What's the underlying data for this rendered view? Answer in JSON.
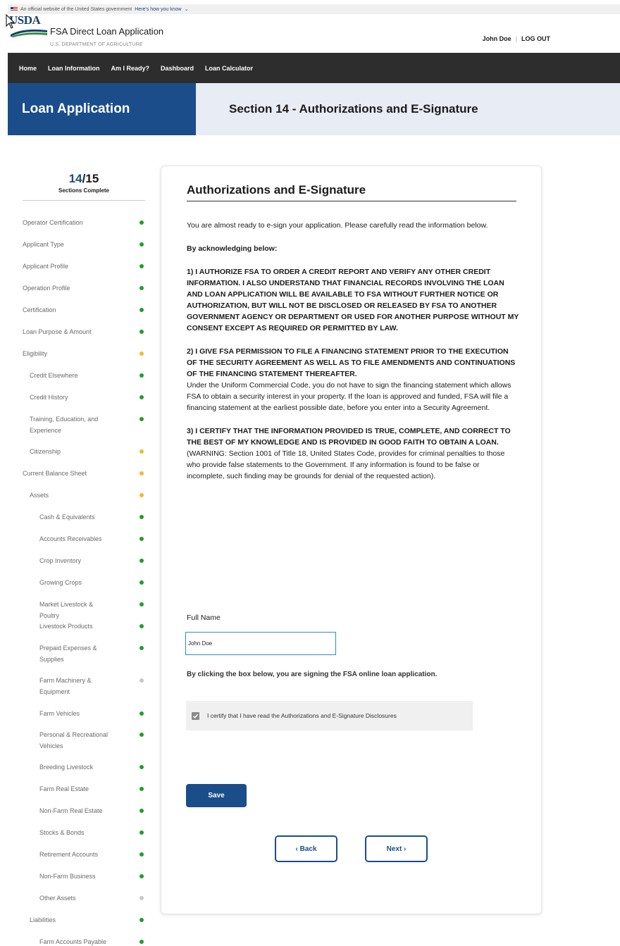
{
  "gov_banner": {
    "text": "An official website of the United States government",
    "how_know": "Here's how you know"
  },
  "header": {
    "logo_text": "USDA",
    "app_title": "FSA Direct Loan Application",
    "department": "U.S. DEPARTMENT OF AGRICULTURE",
    "user_name": "John Doe",
    "separator": "|",
    "logout": "LOG OUT"
  },
  "nav": {
    "items": [
      "Home",
      "Loan Information",
      "Am I Ready?",
      "Dashboard",
      "Loan Calculator"
    ]
  },
  "title_bar": {
    "left": "Loan Application",
    "right": "Section 14 - Authorizations and E-Signature"
  },
  "progress": {
    "done": "14",
    "total": "/15",
    "label": "Sections Complete"
  },
  "sidebar": {
    "items": [
      {
        "label": "Operator Certification",
        "status": "green"
      },
      {
        "label": "Applicant Type",
        "status": "green"
      },
      {
        "label": "Applicant Profile",
        "status": "green"
      },
      {
        "label": "Operation Profile",
        "status": "green"
      },
      {
        "label": "Certification",
        "status": "green"
      },
      {
        "label": "Loan Purpose & Amount",
        "status": "green"
      },
      {
        "label": "Eligibility",
        "status": "yellow"
      },
      {
        "label": "Credit Elsewhere",
        "status": "green"
      },
      {
        "label": "Credit History",
        "status": "green"
      },
      {
        "label": "Training, Education, and Experience",
        "status": "green"
      },
      {
        "label": "Citizenship",
        "status": "yellow"
      },
      {
        "label": "Current Balance Sheet",
        "status": "yellow"
      },
      {
        "label": "Assets",
        "status": "yellow"
      },
      {
        "label": "Cash & Equivalents",
        "status": "green"
      },
      {
        "label": "Accounts Receivables",
        "status": "green"
      },
      {
        "label": "Crop Inventory",
        "status": "green"
      },
      {
        "label": "Growing Crops",
        "status": "green"
      },
      {
        "label": "Market Livestock & Poultry",
        "status": "green"
      },
      {
        "label": "Livestock Products",
        "status": "green"
      },
      {
        "label": "Prepaid Expenses & Supplies",
        "status": "green"
      },
      {
        "label": "Farm Machinery & Equipment",
        "status": "gray"
      },
      {
        "label": "Farm Vehicles",
        "status": "green"
      },
      {
        "label": "Personal & Recreational Vehicles",
        "status": "green"
      },
      {
        "label": "Breeding Livestock",
        "status": "green"
      },
      {
        "label": "Farm Real Estate",
        "status": "green"
      },
      {
        "label": "Non-Farm Real Estate",
        "status": "green"
      },
      {
        "label": "Stocks & Bonds",
        "status": "green"
      },
      {
        "label": "Retirement Accounts",
        "status": "green"
      },
      {
        "label": "Non-Farm Business",
        "status": "green"
      },
      {
        "label": "Other Assets",
        "status": "gray"
      },
      {
        "label": "Liabilities",
        "status": "green"
      },
      {
        "label": "Farm Accounts Payable",
        "status": "green"
      }
    ]
  },
  "main": {
    "title": "Authorizations and E-Signature",
    "intro": "You are almost ready to e-sign your application. Please carefully read the information below.",
    "ack_heading": "By acknowledging below:",
    "p1": "1) I AUTHORIZE FSA TO ORDER A CREDIT REPORT AND VERIFY ANY OTHER CREDIT INFORMATION. I ALSO UNDERSTAND THAT FINANCIAL RECORDS INVOLVING THE LOAN AND LOAN APPLICATION WILL BE AVAILABLE TO FSA WITHOUT FURTHER NOTICE OR AUTHORIZATION, BUT WILL NOT BE DISCLOSED OR RELEASED BY FSA TO ANOTHER GOVERNMENT AGENCY OR DEPARTMENT OR USED FOR ANOTHER PURPOSE WITHOUT MY CONSENT EXCEPT AS REQUIRED OR PERMITTED BY LAW.",
    "p2": "2) I GIVE FSA PERMISSION TO FILE A FINANCING STATEMENT PRIOR TO THE EXECUTION OF THE SECURITY AGREEMENT AS WELL AS TO FILE AMENDMENTS AND CONTINUATIONS OF THE FINANCING STATEMENT THEREAFTER.",
    "p2_detail": "Under the Uniform Commercial Code, you do not have to sign the financing statement which allows FSA to obtain a security interest in your property. If the loan is approved and funded, FSA will file a financing statement at the earliest possible date, before you enter into a Security Agreement.",
    "p3": "3) I CERTIFY THAT THE INFORMATION PROVIDED IS TRUE, COMPLETE, AND CORRECT TO THE BEST OF MY KNOWLEDGE AND IS PROVIDED IN GOOD FAITH TO OBTAIN A LOAN.",
    "p3_detail": "(WARNING: Section 1001 of Title 18, United States Code, provides for criminal penalties to those who provide false statements to the Government. If any information is found to be false or incomplete, such finding may be grounds for denial of the requested action).",
    "full_name_label": "Full Name",
    "full_name_value": "John Doe",
    "sign_note": "By clicking the box below, you are signing the FSA online loan application.",
    "cert_label": "I certify that I have read the Authorizations and E-Signature Disclosures",
    "cert_checked": true,
    "save_label": "Save",
    "back_label": "‹ Back",
    "next_label": "Next ›"
  },
  "colors": {
    "primary": "#1a4d8a",
    "nav_bg": "#2d2d2d",
    "title_right_bg": "#e8ecf4",
    "status_green": "#1f9f2a",
    "status_yellow": "#f5b82e",
    "status_gray": "#c8c8c8"
  }
}
